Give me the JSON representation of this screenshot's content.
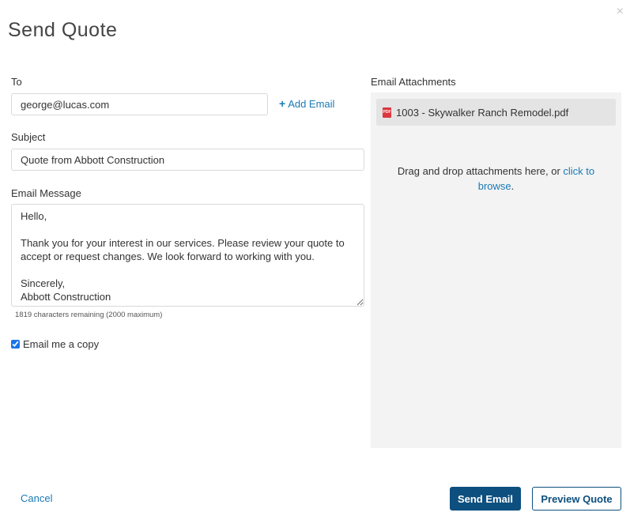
{
  "dialog": {
    "title": "Send Quote",
    "close_glyph": "×"
  },
  "form": {
    "to_label": "To",
    "to_value": "george@lucas.com",
    "add_email_label": "Add Email",
    "subject_label": "Subject",
    "subject_value": "Quote from Abbott Construction",
    "message_label": "Email Message",
    "message_value": "Hello,\n\nThank you for your interest in our services. Please review your quote to accept or request changes. We look forward to working with you.\n\nSincerely,\nAbbott Construction",
    "chars_remaining": "1819 characters remaining (2000 maximum)",
    "copy_label": "Email me a copy",
    "copy_checked": true
  },
  "attachments": {
    "label": "Email Attachments",
    "files": [
      {
        "name": "1003 - Skywalker Ranch Remodel.pdf",
        "icon": "pdf-file-icon",
        "icon_text": "PDF"
      }
    ],
    "dropzone_text": "Drag and drop attachments here, or ",
    "dropzone_link": "click to browse",
    "dropzone_suffix": "."
  },
  "footer": {
    "cancel_label": "Cancel",
    "send_label": "Send Email",
    "preview_label": "Preview Quote"
  },
  "colors": {
    "primary": "#0d4f7e",
    "link": "#1a7ab5",
    "panel_bg": "#f3f3f3",
    "pdf_red": "#d9363e"
  }
}
